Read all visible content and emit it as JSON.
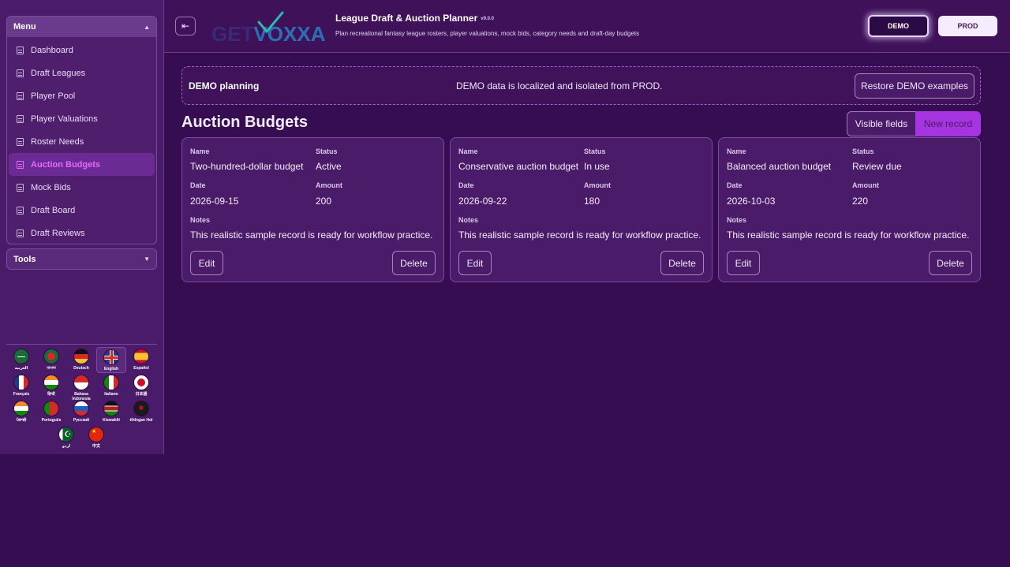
{
  "sidebar": {
    "menu_title": "Menu",
    "items": [
      {
        "label": "Dashboard"
      },
      {
        "label": "Draft Leagues"
      },
      {
        "label": "Player Pool"
      },
      {
        "label": "Player Valuations"
      },
      {
        "label": "Roster Needs"
      },
      {
        "label": "Auction Budgets",
        "active": true
      },
      {
        "label": "Mock Bids"
      },
      {
        "label": "Draft Board"
      },
      {
        "label": "Draft Reviews"
      }
    ],
    "tools_title": "Tools",
    "languages": [
      {
        "label": "العربية",
        "flag": "saudi-arabia"
      },
      {
        "label": "বাংলা",
        "flag": "bangladesh"
      },
      {
        "label": "Deutsch",
        "flag": "germany"
      },
      {
        "label": "English",
        "flag": "united-kingdom",
        "selected": true
      },
      {
        "label": "Español",
        "flag": "spain"
      },
      {
        "label": "Français",
        "flag": "france"
      },
      {
        "label": "हिन्दी",
        "flag": "india"
      },
      {
        "label": "Bahasa Indonesia",
        "flag": "indonesia"
      },
      {
        "label": "Italiano",
        "flag": "italy"
      },
      {
        "label": "日本語",
        "flag": "japan"
      },
      {
        "label": "ਪੰਜਾਬੀ",
        "flag": "india"
      },
      {
        "label": "Português",
        "flag": "portugal"
      },
      {
        "label": "Русский",
        "flag": "russia"
      },
      {
        "label": "Kiswahili",
        "flag": "kenya"
      },
      {
        "label": "tlhIngan Hol",
        "flag": "klingon"
      },
      {
        "label": "اردو",
        "flag": "pakistan"
      },
      {
        "label": "中文",
        "flag": "china"
      }
    ]
  },
  "header": {
    "logo_left": "GET",
    "logo_right": "VOXXA",
    "app_title": "League Draft & Auction Planner",
    "version": "v9.0.0",
    "subtitle": "Plan recreational fantasy league rosters, player valuations, mock bids, category needs and draft-day budgets",
    "demo_label": "DEMO",
    "prod_label": "PROD"
  },
  "banner": {
    "title": "DEMO planning",
    "message": "DEMO data is localized and isolated from PROD.",
    "restore_label": "Restore DEMO examples"
  },
  "page": {
    "title": "Auction Budgets",
    "visible_fields_label": "Visible fields",
    "new_record_label": "New record"
  },
  "field_labels": {
    "name": "Name",
    "status": "Status",
    "date": "Date",
    "amount": "Amount",
    "notes": "Notes"
  },
  "cards": [
    {
      "name": "Two-hundred-dollar budget",
      "status": "Active",
      "date": "2026-09-15",
      "amount": "200",
      "notes": "This realistic sample record is ready for workflow practice.",
      "edit": "Edit",
      "delete": "Delete"
    },
    {
      "name": "Conservative auction budget",
      "status": "In use",
      "date": "2026-09-22",
      "amount": "180",
      "notes": "This realistic sample record is ready for workflow practice.",
      "edit": "Edit",
      "delete": "Delete"
    },
    {
      "name": "Balanced auction budget",
      "status": "Review due",
      "date": "2026-10-03",
      "amount": "220",
      "notes": "This realistic sample record is ready for workflow practice.",
      "edit": "Edit",
      "delete": "Delete"
    }
  ],
  "colors": {
    "background": "#360d50",
    "accent": "#a634e0",
    "active_menu_text": "#e56bff"
  }
}
